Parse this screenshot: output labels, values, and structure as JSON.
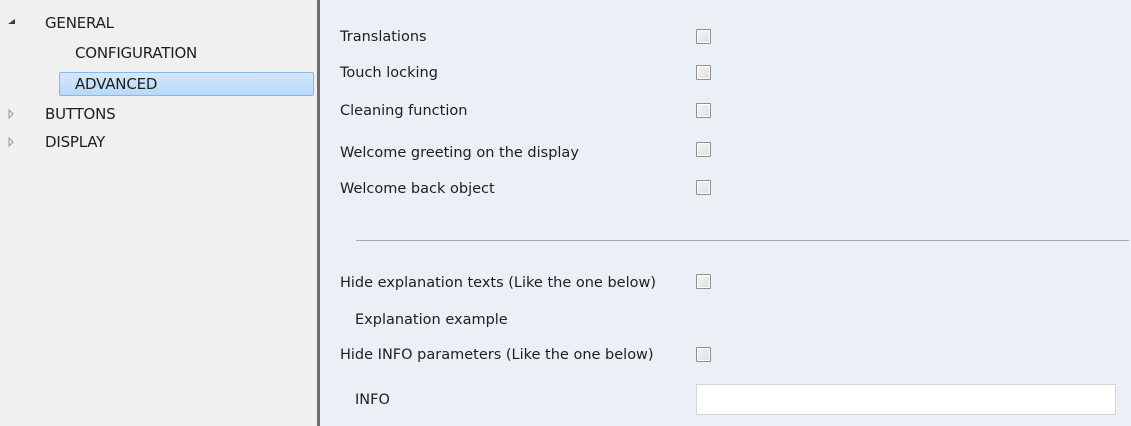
{
  "tree": {
    "items": [
      {
        "label": "GENERAL",
        "expanded": true,
        "arrow": "expanded-triangle-icon"
      },
      {
        "label": "CONFIGURATION"
      },
      {
        "label": "ADVANCED",
        "selected": true
      },
      {
        "label": "BUTTONS",
        "expanded": false,
        "arrow": "collapsed-triangle-icon"
      },
      {
        "label": "DISPLAY",
        "expanded": false,
        "arrow": "collapsed-triangle-icon"
      }
    ]
  },
  "panel": {
    "params": [
      {
        "label": "Translations",
        "checked": false
      },
      {
        "label": "Touch locking",
        "checked": false
      },
      {
        "label": "Cleaning function",
        "checked": false
      },
      {
        "label": "Welcome greeting on the display",
        "checked": false
      },
      {
        "label": "Welcome back object",
        "checked": false
      }
    ],
    "hide_explanation": {
      "label": "Hide explanation texts (Like the one below)",
      "checked": false
    },
    "explanation_example": "Explanation example",
    "hide_info": {
      "label": "Hide INFO parameters (Like the one below)",
      "checked": false
    },
    "info": {
      "label": "INFO",
      "value": ""
    }
  },
  "colors": {
    "tree_background": "#f0f0f0",
    "panel_background": "#eaf0f5",
    "selection_fill": "#c6e0f9",
    "selection_border": "#84b9ea",
    "splitter": "#6e6e6e"
  }
}
